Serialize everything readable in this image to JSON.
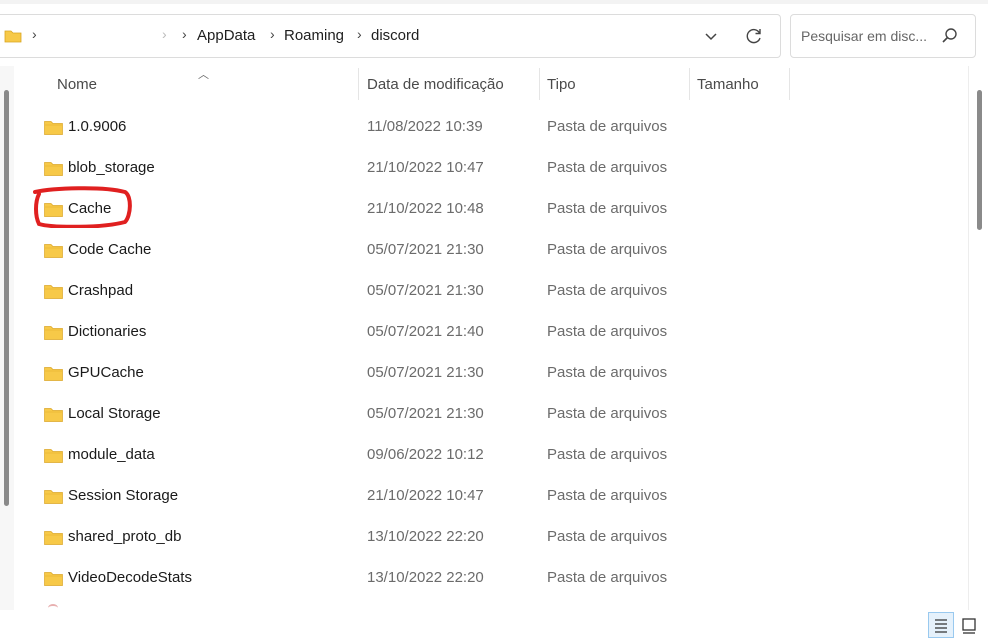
{
  "address_bar": {
    "breadcrumbs": [
      "AppData",
      "Roaming",
      "discord"
    ]
  },
  "search": {
    "placeholder": "Pesquisar em disc..."
  },
  "columns": {
    "name": "Nome",
    "date": "Data de modificação",
    "type": "Tipo",
    "size": "Tamanho"
  },
  "files": [
    {
      "name": "1.0.9006",
      "date": "11/08/2022 10:39",
      "type": "Pasta de arquivos"
    },
    {
      "name": "blob_storage",
      "date": "21/10/2022 10:47",
      "type": "Pasta de arquivos"
    },
    {
      "name": "Cache",
      "date": "21/10/2022 10:48",
      "type": "Pasta de arquivos"
    },
    {
      "name": "Code Cache",
      "date": "05/07/2021 21:30",
      "type": "Pasta de arquivos"
    },
    {
      "name": "Crashpad",
      "date": "05/07/2021 21:30",
      "type": "Pasta de arquivos"
    },
    {
      "name": "Dictionaries",
      "date": "05/07/2021 21:40",
      "type": "Pasta de arquivos"
    },
    {
      "name": "GPUCache",
      "date": "05/07/2021 21:30",
      "type": "Pasta de arquivos"
    },
    {
      "name": "Local Storage",
      "date": "05/07/2021 21:30",
      "type": "Pasta de arquivos"
    },
    {
      "name": "module_data",
      "date": "09/06/2022 10:12",
      "type": "Pasta de arquivos"
    },
    {
      "name": "Session Storage",
      "date": "21/10/2022 10:47",
      "type": "Pasta de arquivos"
    },
    {
      "name": "shared_proto_db",
      "date": "13/10/2022 22:20",
      "type": "Pasta de arquivos"
    },
    {
      "name": "VideoDecodeStats",
      "date": "13/10/2022 22:20",
      "type": "Pasta de arquivos"
    }
  ],
  "colors": {
    "folder": "#f7c948",
    "annotation": "#e02020",
    "selected_view": "#e5f1fb"
  },
  "icons": {
    "folder": "folder-icon",
    "chevron": "chevron-right-icon",
    "dropdown": "chevron-down-icon",
    "refresh": "refresh-icon",
    "search": "search-icon",
    "details_view": "details-view-icon",
    "large_icons_view": "large-icons-view-icon"
  }
}
